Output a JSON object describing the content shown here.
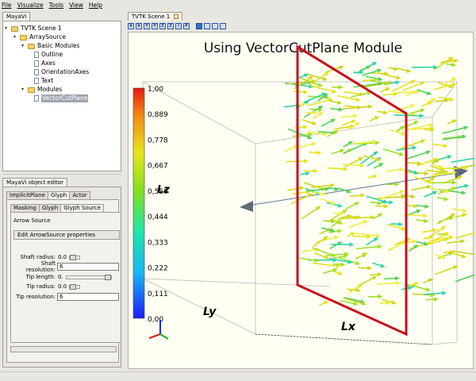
{
  "menu": [
    "File",
    "Visualize",
    "Tools",
    "View",
    "Help"
  ],
  "pipeline_tab": "MayaVi",
  "tree": {
    "scene": "TVTK Scene 1",
    "source": "ArraySource",
    "basic_modules": "Basic Modules",
    "outline": "Outline",
    "axes": "Axes",
    "orientation_axes": "OrientationAxes",
    "text": "Text",
    "modules": "Modules",
    "vcp": "VectorCutPlane"
  },
  "editor": {
    "title": "MayaVi object editor",
    "tabs": [
      "ImplicitPlane",
      "Glyph",
      "Actor"
    ],
    "subtabs": [
      "Masking",
      "Glyph",
      "Glyph Source"
    ],
    "arrow_source": "Arrow Source",
    "edit_button": "Edit ArrowSource properties",
    "shaft_radius_label": "Shaft radius:",
    "shaft_radius": "0.0",
    "shaft_resolution_label": "Shaft resolution:",
    "shaft_resolution": "6",
    "tip_length_label": "Tip length:",
    "tip_length": "0.",
    "tip_radius_label": "Tip radius:",
    "tip_radius": "0.0",
    "tip_resolution_label": "Tip resolution:",
    "tip_resolution": "6"
  },
  "scene_tab": "TVTK Scene 1",
  "toolbar_icons": [
    "view-x-icon",
    "view-x-neg-icon",
    "view-y-icon",
    "view-y-neg-icon",
    "view-z-icon",
    "view-z-neg-icon",
    "view-iso-icon",
    "parallel-projection-icon",
    "save-icon",
    "fullscreen-icon",
    "axes-icon",
    "settings-icon"
  ],
  "toolbar_glyphs": [
    "X",
    "X",
    "Y",
    "Y",
    "Z",
    "Z",
    "I",
    "P"
  ],
  "viz": {
    "title": "Using VectorCutPlane Module",
    "colorbar_ticks": [
      "1,00",
      "0,889",
      "0,778",
      "0,667",
      "0,556",
      "0,444",
      "0,333",
      "0,222",
      "0,111",
      "0,00"
    ],
    "label_lx": "Lx",
    "label_ly": "Ly",
    "label_lz": "Lz",
    "colors": {
      "frame": "#c8101a",
      "axis_arrow": "#5d6b78",
      "glyph_yellow": "#e8e21e",
      "glyph_green": "#56d05a"
    }
  }
}
